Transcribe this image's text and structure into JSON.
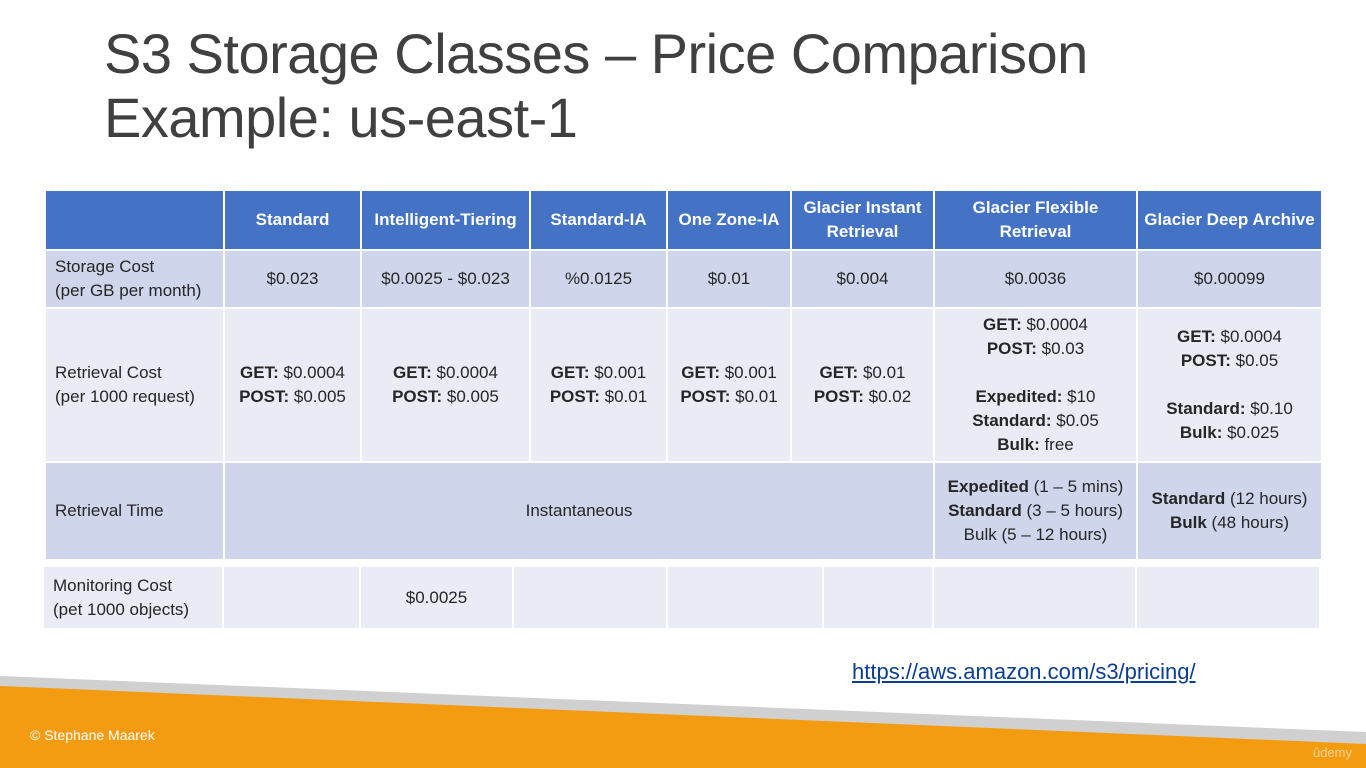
{
  "title": {
    "line1": "S3 Storage Classes – Price Comparison",
    "line2": "Example: us-east-1"
  },
  "table": {
    "headers": [
      "",
      "Standard",
      "Intelligent-Tiering",
      "Standard-IA",
      "One Zone-IA",
      "Glacier Instant Retrieval",
      "Glacier Flexible Retrieval",
      "Glacier Deep Archive"
    ],
    "storage_cost": {
      "label": [
        "Storage Cost",
        "(per GB per month)"
      ],
      "values": [
        "$0.023",
        "$0.0025 - $0.023",
        "%0.0125",
        "$0.01",
        "$0.004",
        "$0.0036",
        "$0.00099"
      ]
    },
    "retrieval_cost": {
      "label": [
        "Retrieval Cost",
        "(per 1000 request)"
      ],
      "values": [
        [
          "GET:",
          " $0.0004",
          "POST:",
          " $0.005"
        ],
        [
          "GET:",
          " $0.0004",
          "POST:",
          " $0.005"
        ],
        [
          "GET:",
          " $0.001",
          "POST:",
          " $0.01"
        ],
        [
          "GET:",
          " $0.001",
          "POST:",
          " $0.01"
        ],
        [
          "GET:",
          " $0.01",
          "POST:",
          " $0.02"
        ]
      ],
      "glacier_flexible": {
        "get_label": "GET:",
        "get_value": " $0.0004",
        "post_label": "POST:",
        "post_value": " $0.03",
        "expedited_label": "Expedited:",
        "expedited_value": " $10",
        "standard_label": "Standard:",
        "standard_value": " $0.05",
        "bulk_label": "Bulk:",
        "bulk_value": " free"
      },
      "glacier_deep": {
        "get_label": "GET:",
        "get_value": " $0.0004",
        "post_label": "POST:",
        "post_value": " $0.05",
        "standard_label": "Standard:",
        "standard_value": " $0.10",
        "bulk_label": "Bulk:",
        "bulk_value": " $0.025"
      }
    },
    "retrieval_time": {
      "label": "Retrieval Time",
      "instant": "Instantaneous",
      "glacier_flexible": {
        "expedited_label": "Expedited",
        "expedited_value": " (1 – 5 mins)",
        "standard_label": "Standard",
        "standard_value": " (3 – 5 hours)",
        "bulk": "Bulk (5 – 12 hours)"
      },
      "glacier_deep": {
        "standard_label": "Standard",
        "standard_value": " (12 hours)",
        "bulk_label": "Bulk",
        "bulk_value": " (48 hours)"
      }
    },
    "monitoring_cost": {
      "label": [
        "Monitoring Cost",
        "(pet 1000 objects)"
      ],
      "intelligent_tiering": "$0.0025"
    }
  },
  "link": "https://aws.amazon.com/s3/pricing/",
  "footer": {
    "copyright": "© Stephane Maarek",
    "watermark": "ûdemy"
  },
  "colors": {
    "header_blue": "#4472c4",
    "row_dark": "#cfd5ea",
    "row_light": "#e9ebf5",
    "footer_orange": "#f39c12",
    "footer_gray": "#d0d0d0"
  }
}
